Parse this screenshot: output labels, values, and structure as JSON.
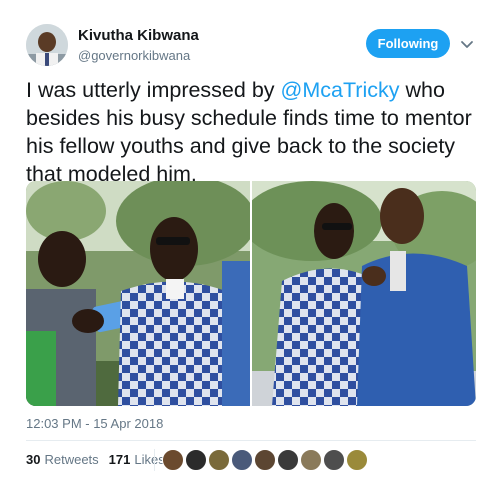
{
  "author": {
    "display_name": "Kivutha Kibwana",
    "handle": "@governorkibwana"
  },
  "follow_button_label": "Following",
  "tweet": {
    "text_before": "I was utterly impressed by ",
    "mention": "@McaTricky",
    "text_after": " who besides his busy schedule finds time to mentor his fellow youths and give back to the society that modeled him."
  },
  "timestamp": "12:03 PM - 15 Apr 2018",
  "stats": {
    "retweets_count": "30",
    "retweets_label": "Retweets",
    "likes_count": "171",
    "likes_label": "Likes"
  },
  "liker_avatar_colors": [
    "#6b4a2e",
    "#2b2b2b",
    "#7a6a3a",
    "#4a5a7a",
    "#5c4632",
    "#3a3a3a",
    "#8a7a5a",
    "#4e4e4e",
    "#9a8a3a"
  ],
  "colors": {
    "accent": "#1da1f2",
    "secondary_text": "#657786",
    "primary_text": "#14171a"
  }
}
